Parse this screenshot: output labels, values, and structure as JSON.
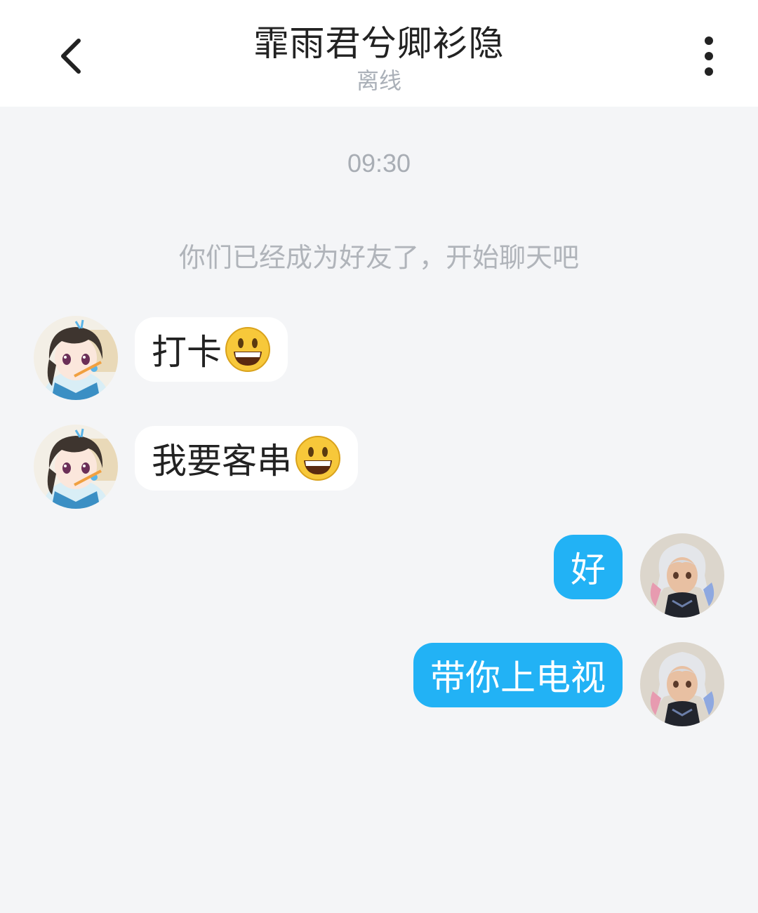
{
  "header": {
    "title": "霏雨君兮卿衫隐",
    "status": "离线"
  },
  "chat": {
    "time": "09:30",
    "system_notice": "你们已经成为好友了，开始聊天吧",
    "messages": [
      {
        "direction": "in",
        "text": "打卡",
        "emoji": "grinning-emoji"
      },
      {
        "direction": "in",
        "text": "我要客串",
        "emoji": "grinning-emoji"
      },
      {
        "direction": "out",
        "text": "好"
      },
      {
        "direction": "out",
        "text": "带你上电视"
      }
    ]
  },
  "colors": {
    "outgoing_bubble": "#22b2f5",
    "incoming_bubble": "#ffffff",
    "background": "#f4f5f7"
  }
}
